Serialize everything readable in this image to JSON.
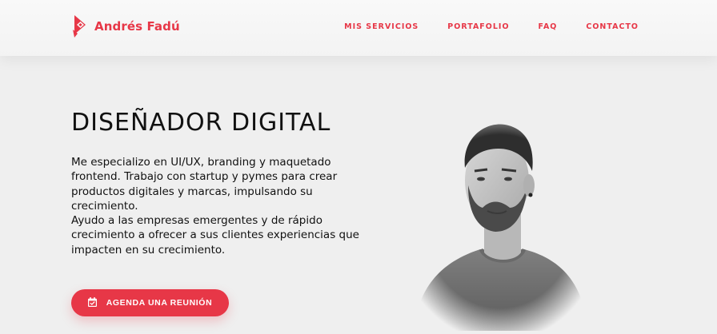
{
  "header": {
    "brand": {
      "logo_icon": "brand-logo-icon",
      "name": "Andrés Fadú"
    },
    "nav": [
      {
        "label": "MIS SERVICIOS"
      },
      {
        "label": "PORTAFOLIO"
      },
      {
        "label": "FAQ"
      },
      {
        "label": "CONTACTO"
      }
    ]
  },
  "hero": {
    "title": "DISEÑADOR DIGITAL",
    "paragraphs": [
      "Me especializo en UI/UX, branding y maquetado frontend. Trabajo con startup y pymes para crear productos digitales y marcas, impulsando su crecimiento.",
      "Ayudo a las empresas emergentes y de rápido crecimiento a ofrecer a sus clientes experiencias que impacten en su crecimiento."
    ],
    "cta": {
      "icon": "calendar-icon",
      "label": "AGENDA UNA REUNIÓN"
    },
    "portrait": "grayscale-portrait-photo"
  },
  "colors": {
    "accent": "#e73747",
    "background": "#efefef",
    "text": "#111111"
  }
}
